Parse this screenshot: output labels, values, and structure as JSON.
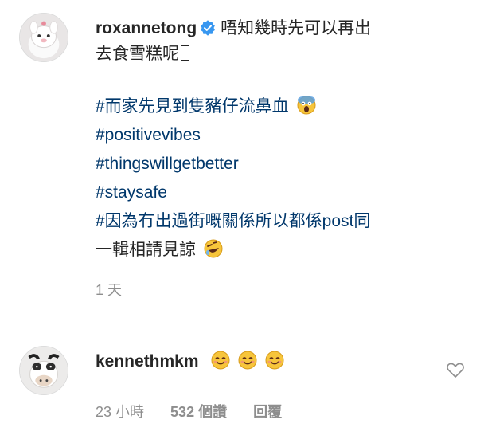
{
  "comment1": {
    "username": "roxannetong",
    "line1": "唔知幾時先可以再出",
    "line2": "去食雪糕呢",
    "hashtags": [
      "#而家先見到隻豬仔流鼻血",
      "#positivevibes",
      "#thingswillgetbetter",
      "#staysafe",
      "#因為冇出過街嘅關係所以都係post同"
    ],
    "last_line": "一輯相請見諒",
    "time": "1 天"
  },
  "comment2": {
    "username": "kennethmkm",
    "time": "23 小時",
    "likes": "532 個讚",
    "reply": "回覆"
  },
  "icons": {
    "verified": "verified-badge-icon",
    "heart": "heart-outline-icon",
    "emoji_scream": "face-screaming-icon",
    "emoji_laugh": "rolling-laughing-icon",
    "emoji_smile": "smiling-face-icon"
  },
  "colors": {
    "hashtag": "#00376b",
    "meta": "#8e8e8e",
    "verified": "#3897f0"
  }
}
